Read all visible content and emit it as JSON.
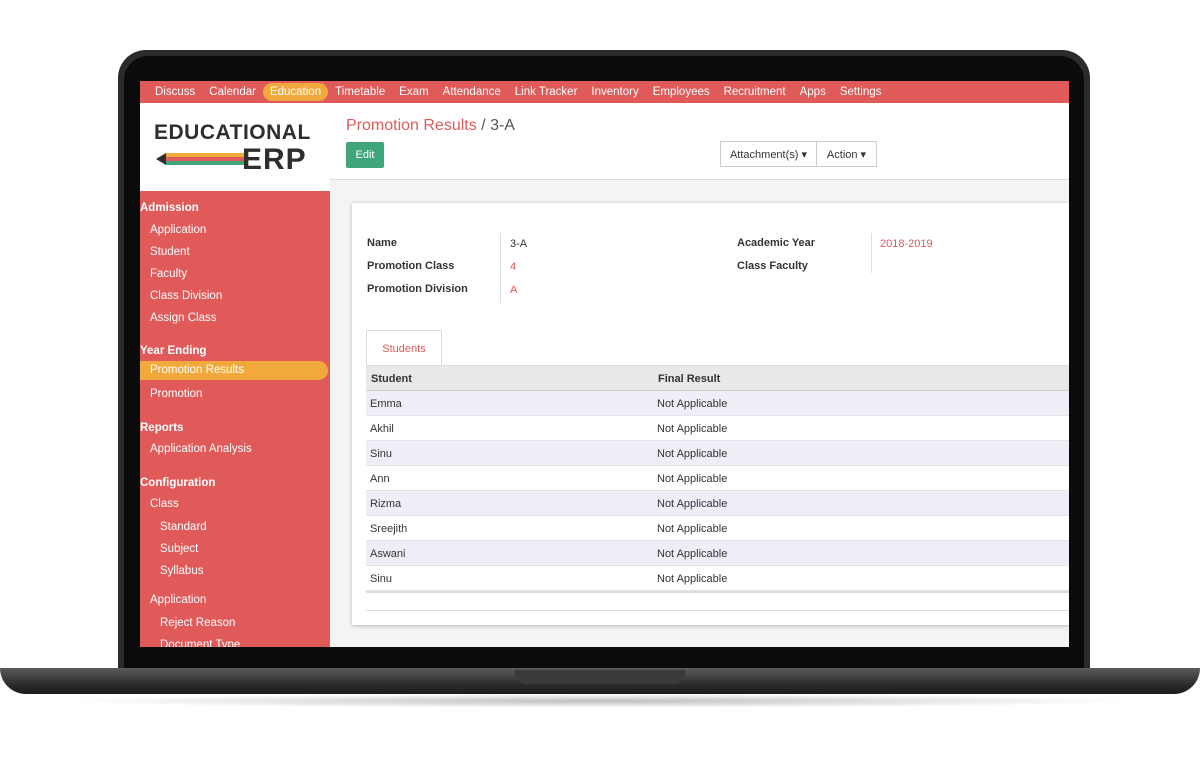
{
  "topnav": {
    "items": [
      "Discuss",
      "Calendar",
      "Education",
      "Timetable",
      "Exam",
      "Attendance",
      "Link Tracker",
      "Inventory",
      "Employees",
      "Recruitment",
      "Apps",
      "Settings"
    ],
    "active": "Education"
  },
  "logo": {
    "line1": "EDUCATIONAL",
    "line2": "ERP"
  },
  "sidebar": {
    "admission": {
      "title": "Admission",
      "items": [
        "Application",
        "Student",
        "Faculty",
        "Class Division",
        "Assign Class"
      ]
    },
    "year_ending": {
      "title": "Year Ending",
      "items": [
        "Promotion Results",
        "Promotion"
      ],
      "active": "Promotion Results"
    },
    "reports": {
      "title": "Reports",
      "items": [
        "Application Analysis"
      ]
    },
    "configuration": {
      "title": "Configuration",
      "class_label": "Class",
      "class_items": [
        "Standard",
        "Subject",
        "Syllabus"
      ],
      "application_label": "Application",
      "application_items": [
        "Reject Reason",
        "Document Type"
      ]
    }
  },
  "breadcrumb": {
    "parent": "Promotion Results",
    "separator": "/",
    "current": "3-A"
  },
  "toolbar": {
    "edit_label": "Edit",
    "attachments_label": "Attachment(s) ▾",
    "action_label": "Action ▾"
  },
  "form": {
    "name_label": "Name",
    "name_value": "3-A",
    "promotion_class_label": "Promotion Class",
    "promotion_class_value": "4",
    "promotion_division_label": "Promotion Division",
    "promotion_division_value": "A",
    "academic_year_label": "Academic Year",
    "academic_year_value": "2018-2019",
    "class_faculty_label": "Class Faculty",
    "class_faculty_value": ""
  },
  "tabs": {
    "students_label": "Students"
  },
  "table": {
    "columns": [
      "Student",
      "Final Result"
    ],
    "rows": [
      [
        "Emma",
        "Not Applicable"
      ],
      [
        "Akhil",
        "Not Applicable"
      ],
      [
        "Sinu",
        "Not Applicable"
      ],
      [
        "Ann",
        "Not Applicable"
      ],
      [
        "Rizma",
        "Not Applicable"
      ],
      [
        "Sreejith",
        "Not Applicable"
      ],
      [
        "Aswani",
        "Not Applicable"
      ],
      [
        "Sinu",
        "Not Applicable"
      ]
    ]
  },
  "colors": {
    "brand_red": "#e05a5a",
    "active_orange": "#f2a93b",
    "edit_green": "#3fa57a"
  }
}
